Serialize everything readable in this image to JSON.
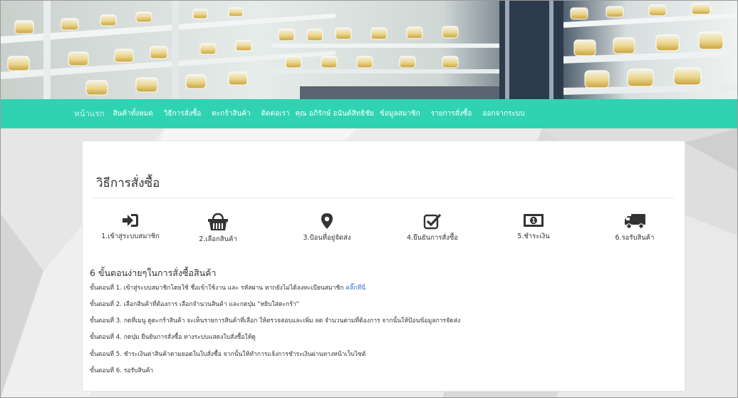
{
  "nav": {
    "items": [
      "หน้าแรก",
      "สินค้าทั้งหมด",
      "วิธีการสั่งซื้อ",
      "ตะกร้าสินค้า",
      "ติดต่อเรา",
      "คุณ อภิรักษ์ อนันต์สิทธิชัย",
      "ข้อมูลสมาชิก",
      "รายการสั่งซื้อ",
      "ออกจากระบบ"
    ]
  },
  "page": {
    "title": "วิธีการสั่งซื้อ",
    "subheading": "6 ขั้นตอนง่ายๆในการสั่งซื้อสินค้า"
  },
  "steps": [
    {
      "label": "1.เข้าสู่ระบบสมาชิก",
      "icon": "sign-in-icon"
    },
    {
      "label": "2.เลือกสินค้า",
      "icon": "basket-icon"
    },
    {
      "label": "3.ป้อนที่อยู่จัดส่ง",
      "icon": "map-marker-icon"
    },
    {
      "label": "4.ยืนยันการสั่งซื้อ",
      "icon": "check-square-icon"
    },
    {
      "label": "5.ชำระเงิน",
      "icon": "money-icon"
    },
    {
      "label": "6.รอรับสินค้า",
      "icon": "truck-icon"
    }
  ],
  "instructions": {
    "line1": "ขั้นตอนที่ 1. เข้าสู่ระบบสมาชิกโดยใช้ ชื่อเข้าใช้งาน และ รหัสผ่าน หากยังไม่ได้ลงทะเบียนสมาชิก",
    "line1_link": "คลิ๊กที่นี่",
    "line2": "ขั้นตอนที่ 2. เลือกสินค้าที่ต้องการ เลือกจำนวนสินค้า และกดปุ่ม \"หยิบใส่ตะกร้า\"",
    "line3": "ขั้นตอนที่ 3. กดที่เมนู ดูตะกร้าสินค้า จะเห็นรายการสินค้าที่เลือก ให้ตรวจสอบและเพิ่ม ลด จำนวนตามที่ต้องการ จากนั้นให้ป้อนข้อมูลการจัดส่ง",
    "line4": "ขั้นตอนที่ 4. กดปุ่ม ยืนยันการสั่งซื้อ ทางระบบแสดงใบสั่งซื้อให้ดู",
    "line5": "ขั้นตอนที่ 5. ชำระเงินค่าสินค้าตามยอดในใบสั่งซื้อ จากนั้นให้ทำการแจ้งการชำระเงินผ่านทางหน้าเว็บไซต์",
    "line6": "ขั้นตอนที่ 6. รอรับสินค้า"
  },
  "colors": {
    "nav_bg": "#2fd3b2",
    "link": "#2a6fd0",
    "icon": "#333333"
  }
}
